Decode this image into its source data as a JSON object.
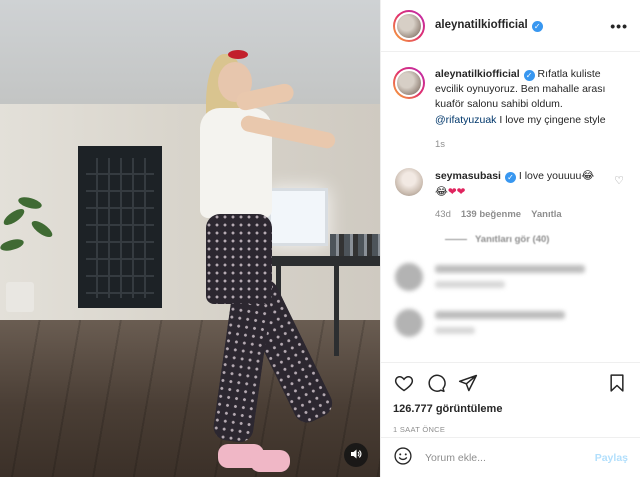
{
  "header": {
    "username": "aleynatilkiofficial",
    "more_label": "•••"
  },
  "caption": {
    "username": "aleynatilkiofficial",
    "text": "Rıfatla kuliste evcilik oynuyoruz. Ben mahalle arası kuaför salonu sahibi oldum.",
    "mention": "@rifatyuzuak",
    "text_after": "I love my çingene style",
    "time": "1s"
  },
  "comment": {
    "username": "seymasubasi",
    "text": "I love youuuu",
    "emoji_inline": "😂",
    "emoji_line": "😂",
    "hearts": "❤❤",
    "time": "43d",
    "likes": "139 beğenme",
    "reply": "Yanıtla",
    "like_icon": "♡",
    "view_replies": "Yanıtları gör (40)"
  },
  "actions": {
    "like_icon": "heart-outline",
    "comment_icon": "speech-bubble",
    "share_icon": "paper-plane",
    "save_icon": "bookmark",
    "views": "126.777 görüntüleme",
    "time_ago": "1 SAAT ÖNCE"
  },
  "composer": {
    "placeholder": "Yorum ekle...",
    "post_label": "Paylaş",
    "emoji_icon": "smiley-face"
  },
  "colors": {
    "verified": "#3897f0",
    "link": "#00376b",
    "muted": "#8e8e8e",
    "post_button": "#b2dffc"
  }
}
